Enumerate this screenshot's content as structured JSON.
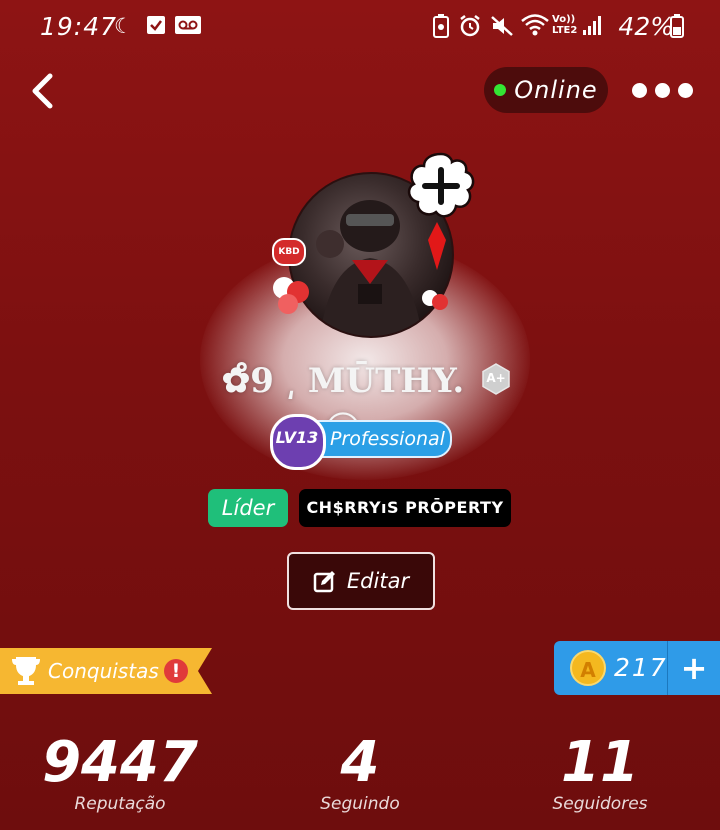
{
  "status_bar": {
    "time": "19:47",
    "battery": "42%",
    "network": "LTE2"
  },
  "header": {
    "online_label": "Online"
  },
  "profile": {
    "name": "✿̊9 ͵ MŪTHY. ⓩ",
    "level": "LV13",
    "level_title": "Professional",
    "tags": [
      "Líder",
      "CH$RRYıS PRŌPERTY"
    ],
    "edit_label": "Editar",
    "rank_badge": "A+"
  },
  "achievements": {
    "label": "Conquistas",
    "alert": "!"
  },
  "coins": {
    "count": "217",
    "add": "+",
    "coin_letter": "A"
  },
  "stats": [
    {
      "value": "9447",
      "label": "Reputação"
    },
    {
      "value": "4",
      "label": "Seguindo"
    },
    {
      "value": "11",
      "label": "Seguidores"
    }
  ],
  "colors": {
    "background": "#8e1414",
    "online_dot": "#34e534",
    "leader_tag": "#1fbf7a",
    "level_pill": "#2b9fe6",
    "coin_panel": "#2f9be8",
    "achievements_ribbon": "#f6b731"
  }
}
